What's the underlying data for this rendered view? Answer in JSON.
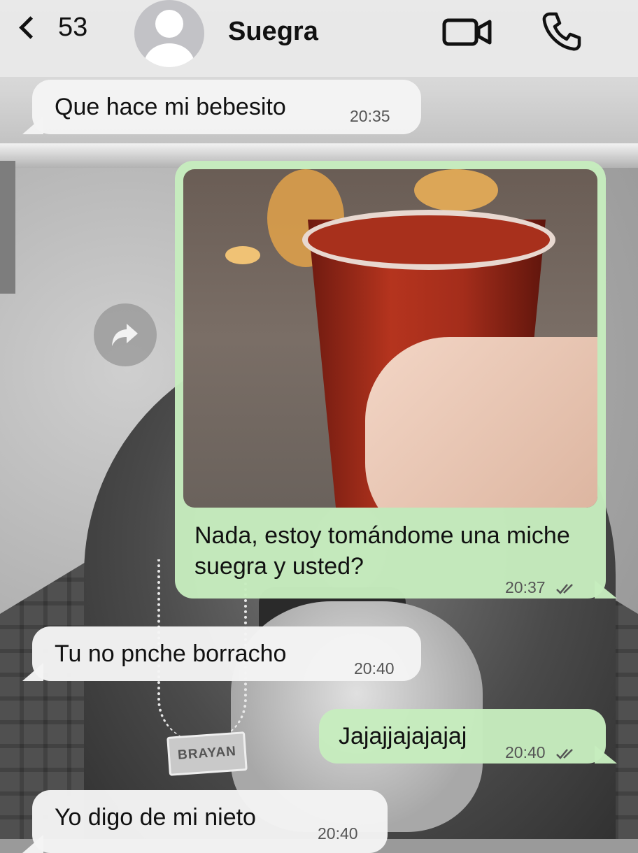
{
  "header": {
    "back_count": "53",
    "contact_name": "Suegra",
    "icons": {
      "back": "chevron-left-icon",
      "avatar": "person-icon",
      "video": "video-call-icon",
      "phone": "phone-call-icon"
    }
  },
  "background": {
    "pendant_text": "BRAYAN"
  },
  "messages": [
    {
      "direction": "incoming",
      "text": "Que hace mi bebesito",
      "time": "20:35"
    },
    {
      "direction": "outgoing",
      "has_photo": true,
      "text": "Nada, estoy tomándome una miche suegra y usted?",
      "time": "20:37",
      "status": "read"
    },
    {
      "direction": "incoming",
      "text": "Tu no pnche borracho",
      "time": "20:40"
    },
    {
      "direction": "outgoing",
      "text": "Jajajjajajajaj",
      "time": "20:40",
      "status": "read"
    },
    {
      "direction": "incoming",
      "text": "Yo digo de mi nieto",
      "time": "20:40"
    }
  ],
  "colors": {
    "incoming_bubble": "#f4f4f4",
    "outgoing_bubble": "#c6ecbe",
    "header_bg": "#e8e8e8"
  },
  "forward_icon": "forward-arrow-icon"
}
